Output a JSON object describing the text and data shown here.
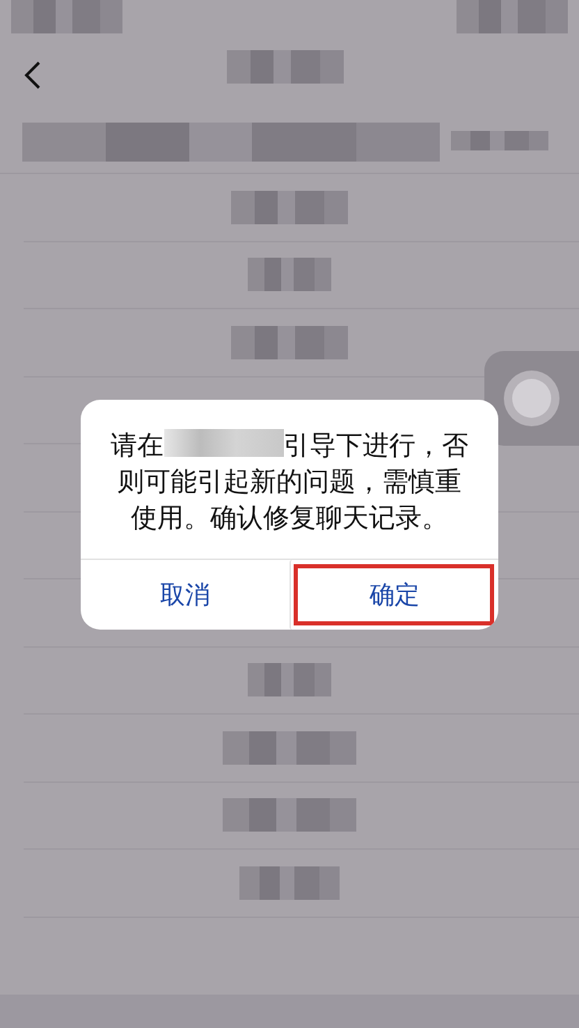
{
  "dialog": {
    "message_start": "请在",
    "message_end": "引导下进行，否则可能引起新的问题，需慎重使用。确认修复聊天记录。",
    "buttons": [
      {
        "label": "取消",
        "highlighted": false
      },
      {
        "label": "确定",
        "highlighted": true
      }
    ]
  }
}
